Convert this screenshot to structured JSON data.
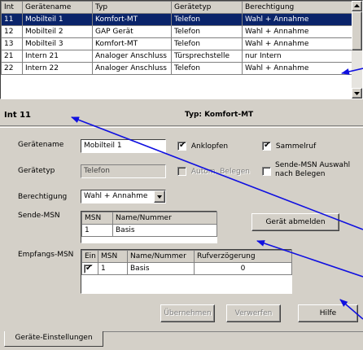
{
  "device_table": {
    "headers": [
      "Int",
      "Gerätename",
      "Typ",
      "Gerätetyp",
      "Berechtigung"
    ],
    "rows": [
      {
        "int": "11",
        "name": "Mobilteil 1",
        "typ": "Komfort-MT",
        "geraetetyp": "Telefon",
        "berechtigung": "Wahl + Annahme",
        "selected": true
      },
      {
        "int": "12",
        "name": "Mobilteil 2",
        "typ": "GAP Gerät",
        "geraetetyp": "Telefon",
        "berechtigung": "Wahl + Annahme"
      },
      {
        "int": "13",
        "name": "Mobilteil 3",
        "typ": "Komfort-MT",
        "geraetetyp": "Telefon",
        "berechtigung": "Wahl + Annahme"
      },
      {
        "int": "21",
        "name": "Intern 21",
        "typ": "Analoger Anschluss",
        "geraetetyp": "Türsprechstelle",
        "berechtigung": "nur Intern"
      },
      {
        "int": "22",
        "name": "Intern 22",
        "typ": "Analoger Anschluss",
        "geraetetyp": "Telefon",
        "berechtigung": "Wahl + Annahme"
      }
    ]
  },
  "detail_header": {
    "int_label": "Int 11",
    "typ_label": "Typ: Komfort-MT"
  },
  "form": {
    "geraetename_label": "Gerätename",
    "geraetename_value": "Mobilteil 1",
    "anklopfen_label": "Anklopfen",
    "anklopfen_checked": true,
    "sammelruf_label": "Sammelruf",
    "sammelruf_checked": true,
    "geraetetyp_label": "Gerätetyp",
    "geraetetyp_value": "Telefon",
    "autom_belegen_label": "Autom. Belegen",
    "sende_msn_auswahl_label_1": "Sende-MSN Auswahl",
    "sende_msn_auswahl_label_2": "nach Belegen",
    "berechtigung_label": "Berechtigung",
    "berechtigung_value": "Wahl + Annahme",
    "sende_msn_label": "Sende-MSN",
    "sende_msn_headers": [
      "MSN",
      "Name/Nummer"
    ],
    "sende_msn_rows": [
      {
        "msn": "1",
        "name": "Basis"
      }
    ],
    "geraet_abmelden_label": "Gerät abmelden",
    "empfangs_msn_label": "Empfangs-MSN",
    "empfangs_msn_headers": [
      "Ein",
      "MSN",
      "Name/Nummer",
      "Rufverzögerung"
    ],
    "empfangs_msn_rows": [
      {
        "ein": true,
        "msn": "1",
        "name": "Basis",
        "delay": "0"
      }
    ]
  },
  "buttons": {
    "uebernehmen": "Übernehmen",
    "verwerfen": "Verwerfen",
    "hilfe": "Hilfe"
  },
  "tabs": {
    "geraete_einstellungen": "Geräte-Einstellungen"
  },
  "colors": {
    "selection": "#0a246a",
    "callout_arrow": "#1010e0",
    "face": "#d4d0c8"
  }
}
